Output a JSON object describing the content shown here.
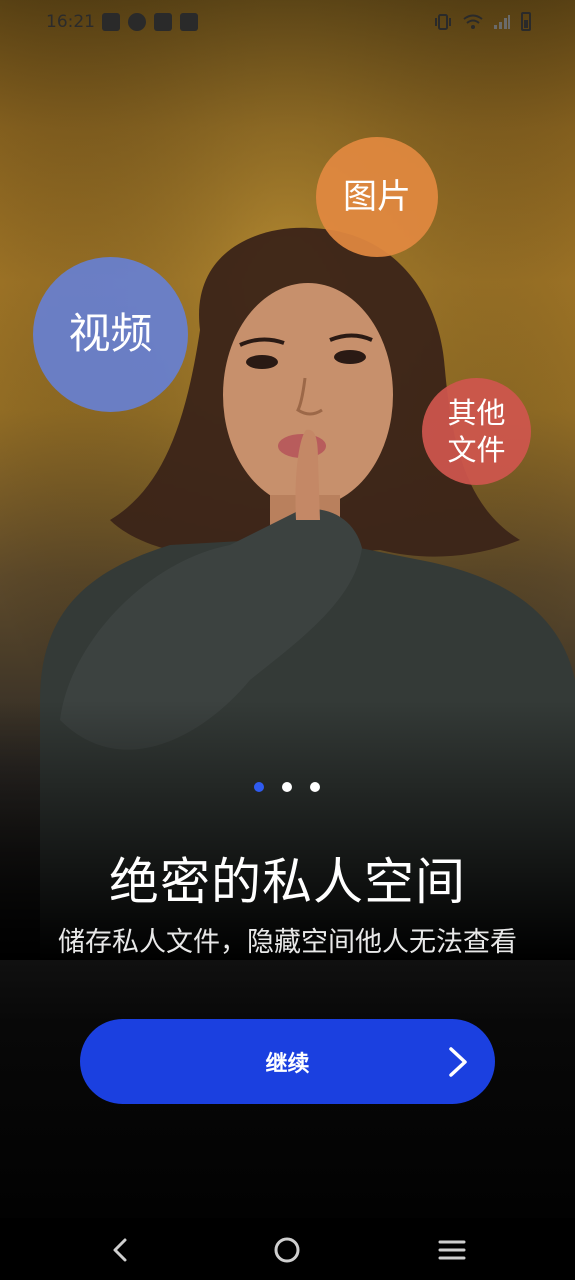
{
  "status_bar": {
    "time": "16:21",
    "left_icons": [
      "message-icon",
      "check-circle-icon",
      "calendar-icon",
      "mail-icon"
    ],
    "right_icons": [
      "vibrate-icon",
      "wifi-icon",
      "signal-icon",
      "battery-icon"
    ]
  },
  "bubbles": {
    "video": "视频",
    "photo": "图片",
    "other_line1": "其他",
    "other_line2": "文件"
  },
  "pager": {
    "count": 3,
    "active_index": 0
  },
  "title": "绝密的私人空间",
  "subtitle": "储存私人文件，隐藏空间他人无法查看",
  "continue_button": {
    "label": "继续"
  },
  "colors": {
    "accent": "#1b40e0",
    "dot_active": "#2f5bf0",
    "bubble_video": "#6780d2",
    "bubble_photo": "#e28940",
    "bubble_other": "#cf564e"
  },
  "nav_bar": {
    "icons": [
      "back-icon",
      "home-icon",
      "recents-icon"
    ]
  }
}
